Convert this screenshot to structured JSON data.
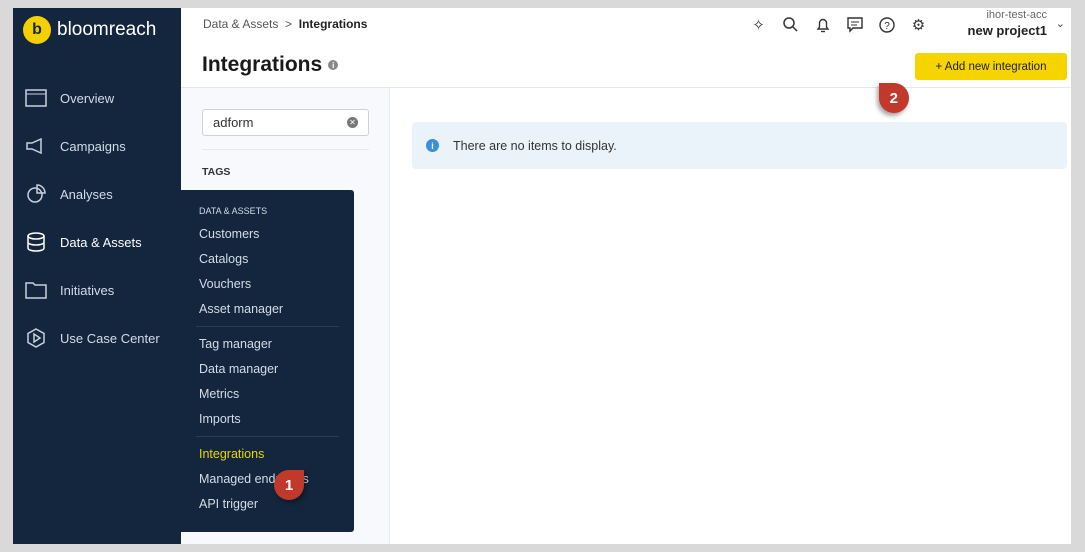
{
  "brand": {
    "name": "bloomreach",
    "mark": "b"
  },
  "sidebar": {
    "items": [
      {
        "label": "Overview"
      },
      {
        "label": "Campaigns"
      },
      {
        "label": "Analyses"
      },
      {
        "label": "Data & Assets"
      },
      {
        "label": "Initiatives"
      },
      {
        "label": "Use Case Center"
      }
    ]
  },
  "header": {
    "breadcrumb_parent": "Data & Assets",
    "breadcrumb_sep": ">",
    "breadcrumb_current": "Integrations",
    "title": "Integrations",
    "account": "ihor-test-acc",
    "project": "new project1",
    "add_button": "+ Add new integration"
  },
  "filters": {
    "search_value": "adform",
    "tags_label": "TAGS"
  },
  "main": {
    "empty_message": "There are no items to display."
  },
  "flyout": {
    "heading": "DATA & ASSETS",
    "group1": [
      "Customers",
      "Catalogs",
      "Vouchers",
      "Asset manager"
    ],
    "group2": [
      "Tag manager",
      "Data manager",
      "Metrics",
      "Imports"
    ],
    "group3": [
      "Integrations",
      "Managed endpoints",
      "API trigger"
    ]
  },
  "markers": [
    "1",
    "2"
  ]
}
